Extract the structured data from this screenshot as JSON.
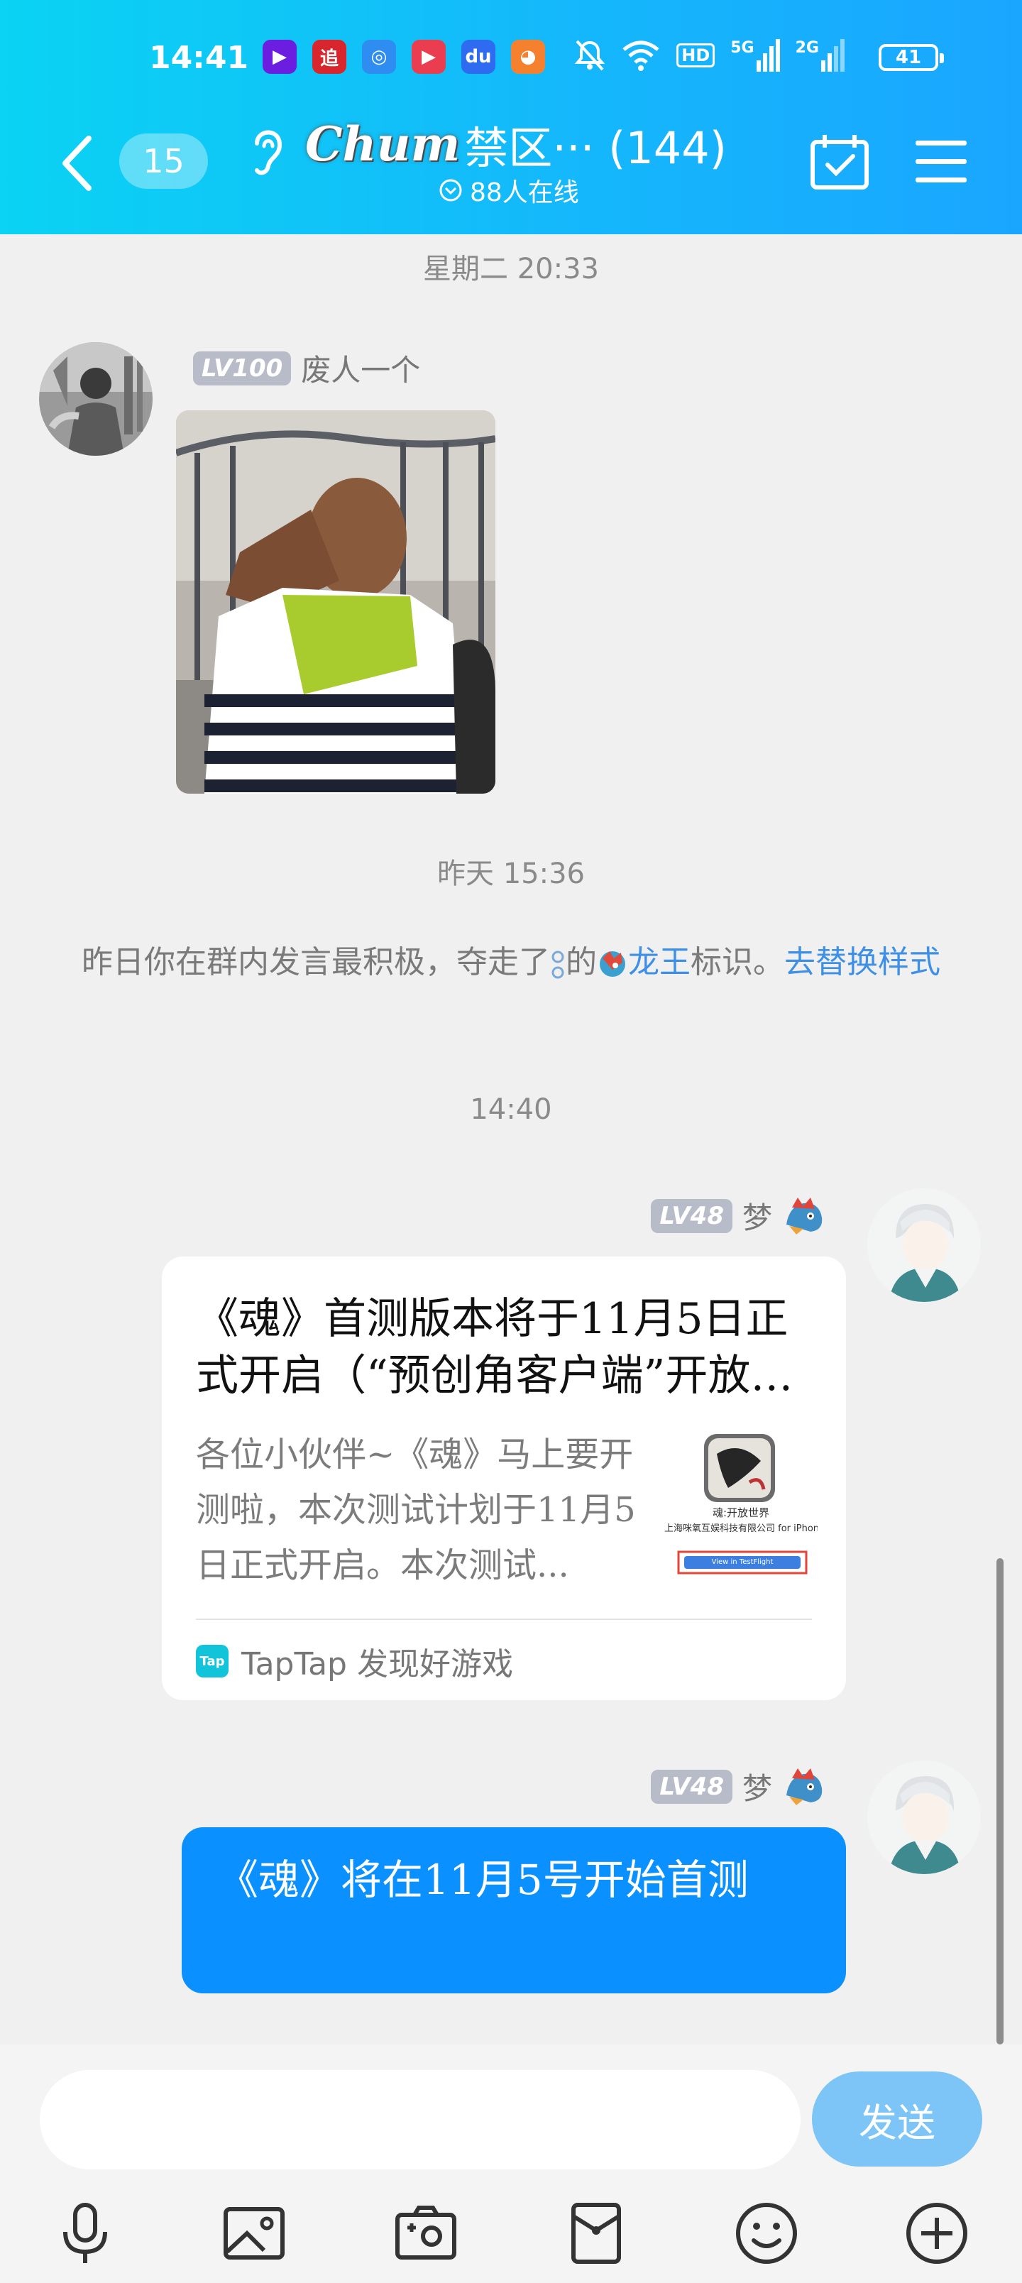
{
  "status_bar": {
    "time": "14:41",
    "app_icons": [
      {
        "icon": "video-app-icon",
        "glyph": "▶",
        "color": "#6b1ee0"
      },
      {
        "icon": "zhui-app-icon",
        "glyph": "追",
        "color": "#d9262c"
      },
      {
        "icon": "browser-app-icon",
        "glyph": "◎",
        "color": "#2f8cf0"
      },
      {
        "icon": "play-app-icon",
        "glyph": "▶",
        "color": "#ea3d4f"
      },
      {
        "icon": "baidu-app-icon",
        "glyph": "du",
        "color": "#2e6bf0"
      },
      {
        "icon": "weibo-app-icon",
        "glyph": "◕",
        "color": "#f5812e"
      }
    ],
    "hd_label": "HD",
    "signal_1": "5G",
    "signal_2": "2G",
    "battery": "41"
  },
  "header": {
    "unread_count": "15",
    "logo_text": "Chum",
    "group_title": "禁区··· (144)",
    "online_text": "88人在线"
  },
  "chat": {
    "ts_1": "星期二 20:33",
    "msg_1": {
      "level": "LV100",
      "nickname": "废人一个"
    },
    "ts_2": "昨天 15:36",
    "notice": {
      "before": "昨日你在群内发言最积极，夺走了",
      "middle": "的",
      "title": "龙王",
      "after": "标识。",
      "link": "去替换样式"
    },
    "ts_3": "14:40",
    "msg_2": {
      "level": "LV48",
      "nickname": "梦",
      "share_title": "《魂》首测版本将于11月5日正式开启（“预创角客户端”开放下载）",
      "share_desc": "各位小伙伴~《魂》马上要开测啦，本次测试计划于11月5日正式开启。本次测试...",
      "thumb_line1": "魂:开放世界",
      "thumb_line2": "上海咪氧互娱科技有限公司 for iPhone",
      "thumb_button": "View in TestFlight",
      "source_logo": "Tap",
      "source_text": "TapTap 发现好游戏"
    },
    "msg_3": {
      "level": "LV48",
      "nickname": "梦",
      "text": "《魂》将在11月5号开始首测"
    }
  },
  "input": {
    "placeholder": "",
    "send_label": "发送"
  },
  "toolbar": [
    "microphone-icon",
    "image-icon",
    "camera-icon",
    "red-packet-icon",
    "emoji-icon",
    "plus-icon"
  ]
}
